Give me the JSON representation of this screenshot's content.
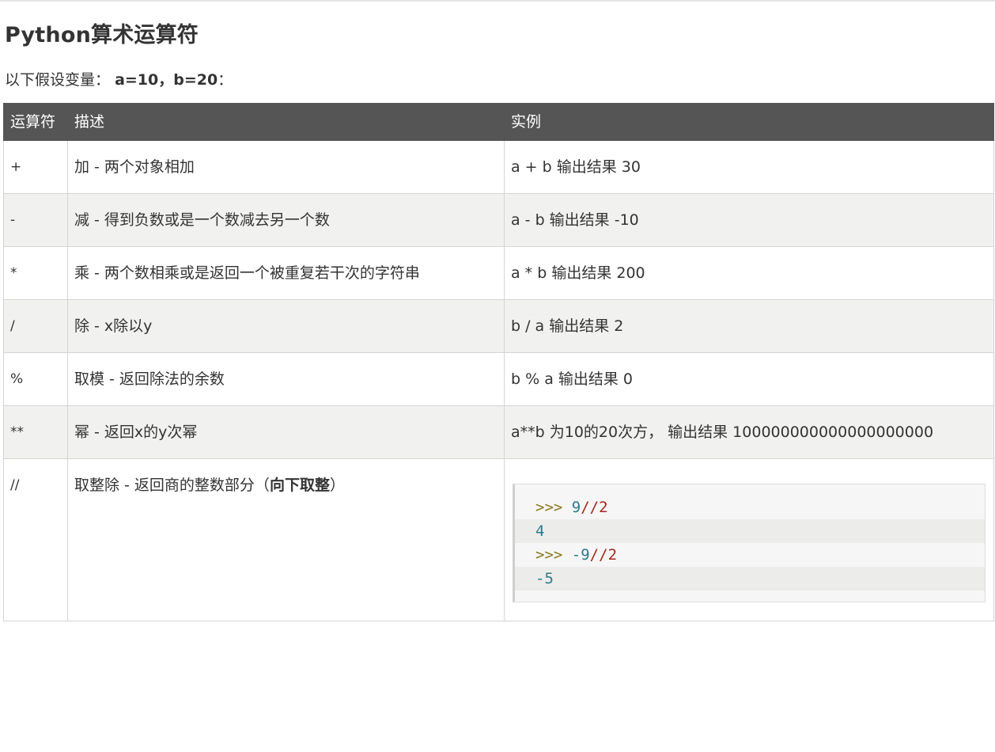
{
  "title": "Python算术运算符",
  "intro": {
    "prefix": "以下假设变量：",
    "vars": "a=10，b=20",
    "suffix": "："
  },
  "table": {
    "headers": [
      "运算符",
      "描述",
      "实例"
    ],
    "rows": [
      {
        "op": "+",
        "desc": "加 - 两个对象相加",
        "example": "a + b 输出结果 30"
      },
      {
        "op": "-",
        "desc": "减 - 得到负数或是一个数减去另一个数",
        "example": "a - b 输出结果 -10"
      },
      {
        "op": "*",
        "desc": "乘 - 两个数相乘或是返回一个被重复若干次的字符串",
        "example": "a * b 输出结果 200"
      },
      {
        "op": "/",
        "desc": "除 - x除以y",
        "example": "b / a 输出结果 2"
      },
      {
        "op": "%",
        "desc": "取模 - 返回除法的余数",
        "example": "b % a 输出结果 0"
      },
      {
        "op": "**",
        "desc": "幂 - 返回x的y次幂",
        "example": "a**b 为10的20次方， 输出结果 100000000000000000000"
      },
      {
        "op": "//",
        "desc": "取整除 - 返回商的整数部分（",
        "desc_bold": "向下取整",
        "desc_tail": "）"
      }
    ],
    "code": {
      "prompt": ">>>",
      "line1_num": "9",
      "line1_op": "//",
      "line1_num2": "2",
      "out1": "4",
      "line3_neg": "-9",
      "line3_op": "//",
      "line3_num2": "2",
      "out2": "-5"
    }
  }
}
